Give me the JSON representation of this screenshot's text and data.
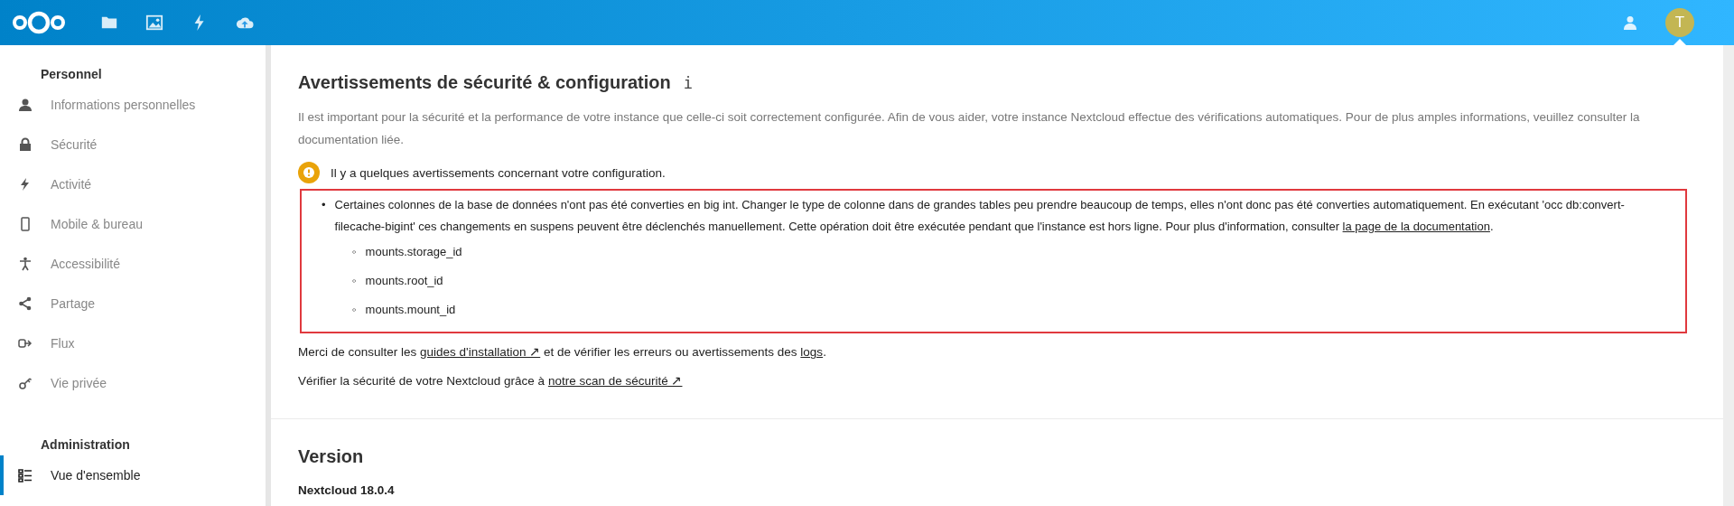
{
  "header": {
    "apps": [
      {
        "kind": "files"
      },
      {
        "kind": "photos"
      },
      {
        "kind": "activity"
      },
      {
        "kind": "upload"
      }
    ],
    "avatar": {
      "initial": "T"
    }
  },
  "sidebar": {
    "sections": [
      {
        "title": "Personnel",
        "items": [
          {
            "label": "Informations personnelles",
            "kind": "user",
            "selected": false
          },
          {
            "label": "Sécurité",
            "kind": "lock",
            "selected": false
          },
          {
            "label": "Activité",
            "kind": "activity",
            "selected": false
          },
          {
            "label": "Mobile & bureau",
            "kind": "phone",
            "selected": false
          },
          {
            "label": "Accessibilité",
            "kind": "person",
            "selected": false
          },
          {
            "label": "Partage",
            "kind": "share",
            "selected": false
          },
          {
            "label": "Flux",
            "kind": "flow",
            "selected": false
          },
          {
            "label": "Vie privée",
            "kind": "key",
            "selected": false
          }
        ]
      },
      {
        "title": "Administration",
        "items": [
          {
            "label": "Vue d'ensemble",
            "kind": "list",
            "selected": true
          }
        ]
      }
    ]
  },
  "content": {
    "title": "Avertissements de sécurité & configuration",
    "info_mark": "i",
    "intro": "Il est important pour la sécurité et la performance de votre instance que celle-ci soit correctement configurée. Afin de vous aider, votre instance Nextcloud effectue des vérifications automatiques. Pour de plus amples informations, veuillez consulter la documentation liée.",
    "warning_summary": "Il y a quelques avertissements concernant votre configuration.",
    "warnings": [
      {
        "highlighted": true,
        "marker": "•",
        "segments": [
          {
            "text": "Certaines colonnes de la base de données n'ont pas été converties en big int. Changer le type de colonne dans de grandes tables peu prendre beaucoup de temps, elles n'ont donc pas été converties automatiquement. En exécutant 'occ db:convert-filecache-bigint' ces changements en suspens peuvent être déclenchés manuellement. Cette opération doit être exécutée pendant que l'instance est hors ligne. Pour plus d'information, consulter "
          },
          {
            "text": "la page de la documentation",
            "kind": "link"
          },
          {
            "text": "."
          }
        ],
        "children": [
          {
            "marker": "◦",
            "text": "mounts.storage_id"
          },
          {
            "marker": "◦",
            "text": "mounts.root_id"
          },
          {
            "marker": "◦",
            "text": "mounts.mount_id"
          }
        ]
      }
    ],
    "paragraphs": [
      [
        {
          "text": "Merci de consulter les "
        },
        {
          "text": "guides d'installation ↗",
          "kind": "link"
        },
        {
          "text": " et de vérifier les erreurs ou avertissements des "
        },
        {
          "text": "logs",
          "kind": "link"
        },
        {
          "text": "."
        }
      ],
      [
        {
          "text": "Vérifier la sécurité de votre Nextcloud grâce à "
        },
        {
          "text": "notre scan de sécurité ↗",
          "kind": "link"
        }
      ]
    ],
    "version": {
      "title": "Version",
      "text": "Nextcloud 18.0.4"
    }
  }
}
